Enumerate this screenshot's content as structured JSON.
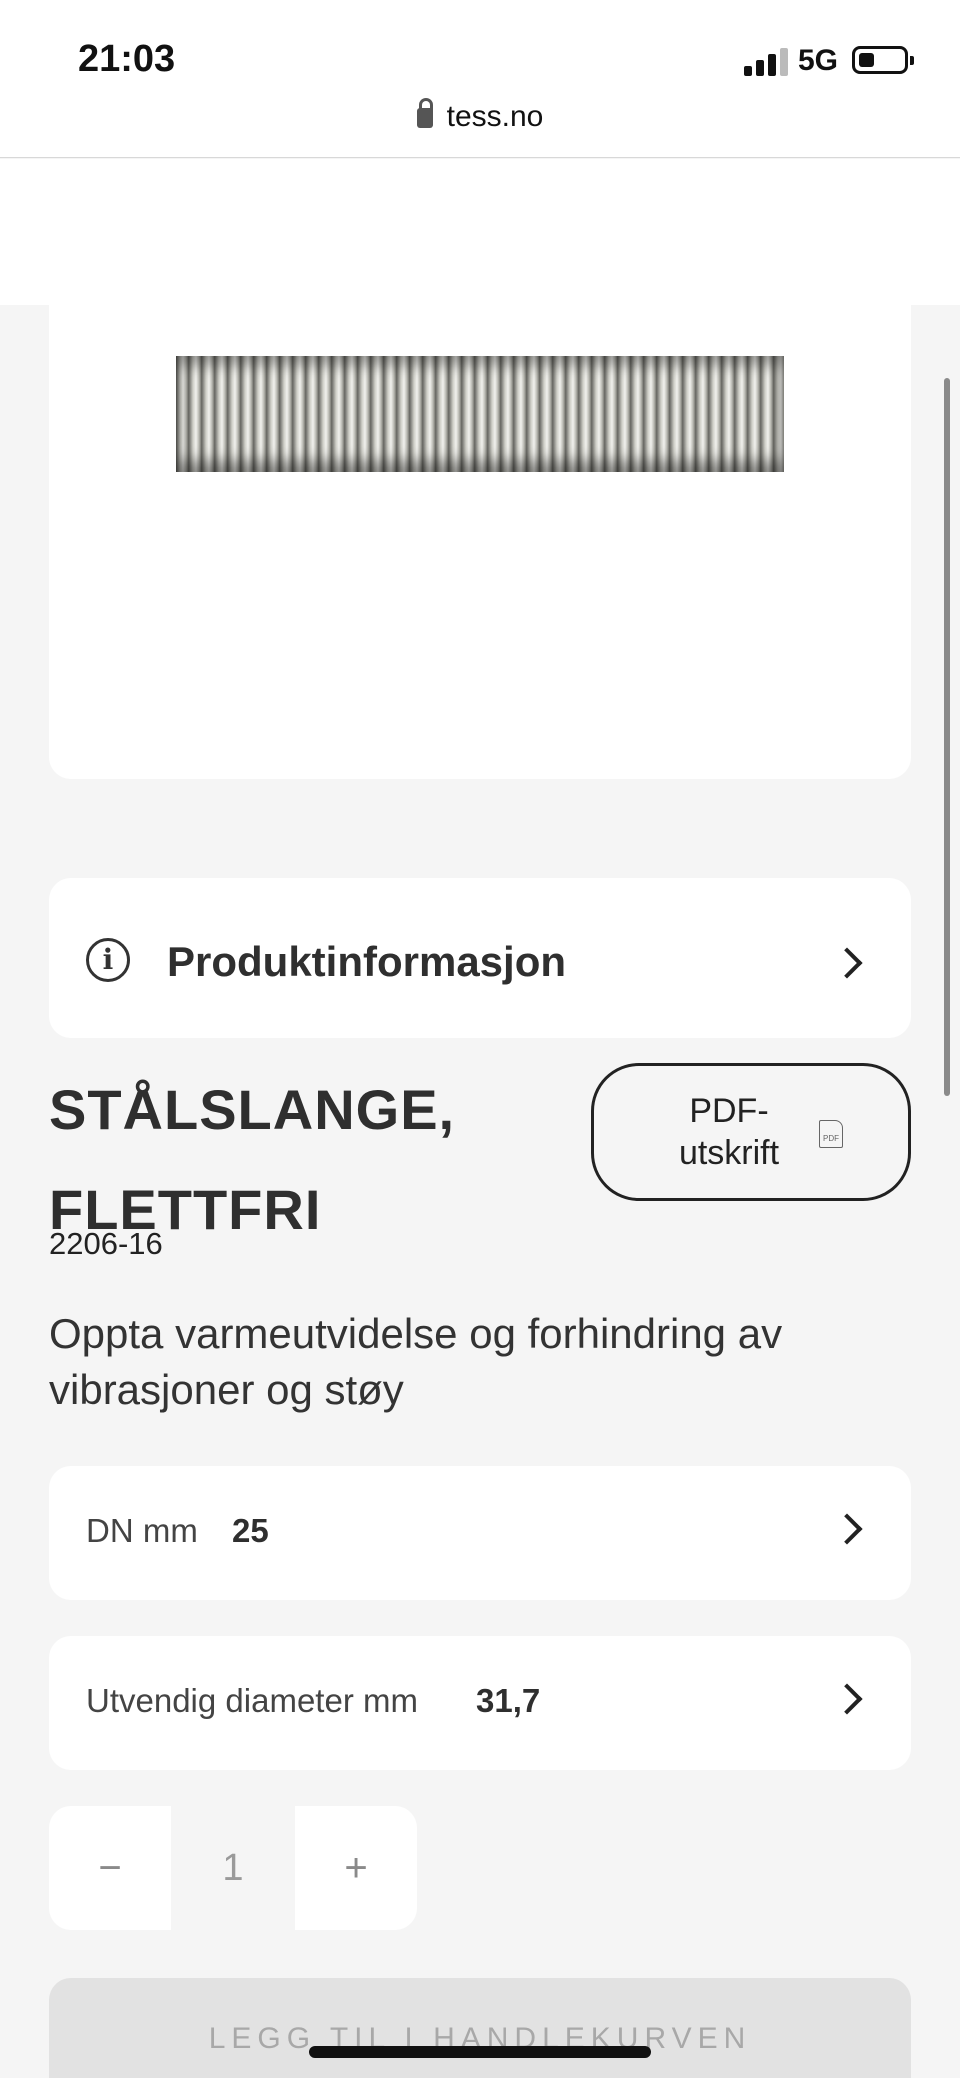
{
  "status_bar": {
    "time": "21:03",
    "network": "5G",
    "battery_level": 0.35
  },
  "browser": {
    "url": "tess.no"
  },
  "product": {
    "image_alt": "Stålslange",
    "info_section_label": "Produktinformasjon",
    "title": "STÅLSLANGE, FLETTFRI",
    "sku": "2206-16",
    "description": "Oppta varmeutvidelse og forhindring av vibrasjoner og støy",
    "pdf_button_label": "PDF-\nutskrift",
    "pdf_icon_text": "PDF"
  },
  "options": [
    {
      "label": "DN mm",
      "value": "25"
    },
    {
      "label": "Utvendig diameter mm",
      "value": "31,7"
    }
  ],
  "quantity": {
    "minus": "−",
    "value": "1",
    "plus": "+"
  },
  "cart": {
    "add_label": "LEGG TIL I HANDLEKURVEN"
  }
}
